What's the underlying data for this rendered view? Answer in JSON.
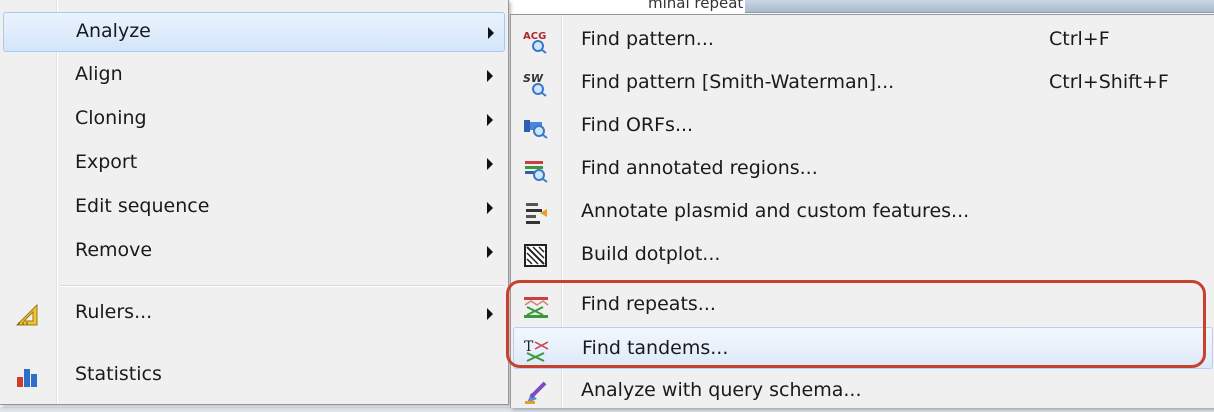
{
  "background": {
    "partial_text": "minal repeat"
  },
  "main_menu": {
    "items": [
      {
        "label": "Analyze",
        "has_submenu": true,
        "highlighted": true
      },
      {
        "label": "Align",
        "has_submenu": true
      },
      {
        "label": "Cloning",
        "has_submenu": true
      },
      {
        "label": "Export",
        "has_submenu": true
      },
      {
        "label": "Edit sequence",
        "has_submenu": true
      },
      {
        "label": "Remove",
        "has_submenu": true
      },
      {
        "label": "Rulers...",
        "has_submenu": true,
        "icon": "ruler-icon"
      },
      {
        "label": "Statistics",
        "has_submenu": false,
        "icon": "bar-chart-icon"
      }
    ]
  },
  "sub_menu": {
    "items": [
      {
        "label": "Find pattern...",
        "shortcut": "Ctrl+F",
        "icon": "find-pattern-icon",
        "icon_text": "ACG"
      },
      {
        "label": "Find pattern [Smith-Waterman]...",
        "shortcut": "Ctrl+Shift+F",
        "icon": "smith-waterman-icon",
        "icon_text": "SW"
      },
      {
        "label": "Find ORFs...",
        "shortcut": "",
        "icon": "find-orfs-icon"
      },
      {
        "label": "Find annotated regions...",
        "shortcut": "",
        "icon": "find-annotated-icon"
      },
      {
        "label": "Annotate plasmid and custom features...",
        "shortcut": "",
        "icon": "annotate-plasmid-icon"
      },
      {
        "label": "Build dotplot...",
        "shortcut": "",
        "icon": "dotplot-icon"
      },
      {
        "label": "Find repeats...",
        "shortcut": "",
        "icon": "find-repeats-icon"
      },
      {
        "label": "Find tandems...",
        "shortcut": "",
        "icon": "find-tandems-icon",
        "highlighted": true
      },
      {
        "label": "Analyze with query schema...",
        "shortcut": "",
        "icon": "query-schema-icon"
      }
    ]
  },
  "colors": {
    "annotation_outline": "#c8412f",
    "hover": "#d4e6fb"
  }
}
